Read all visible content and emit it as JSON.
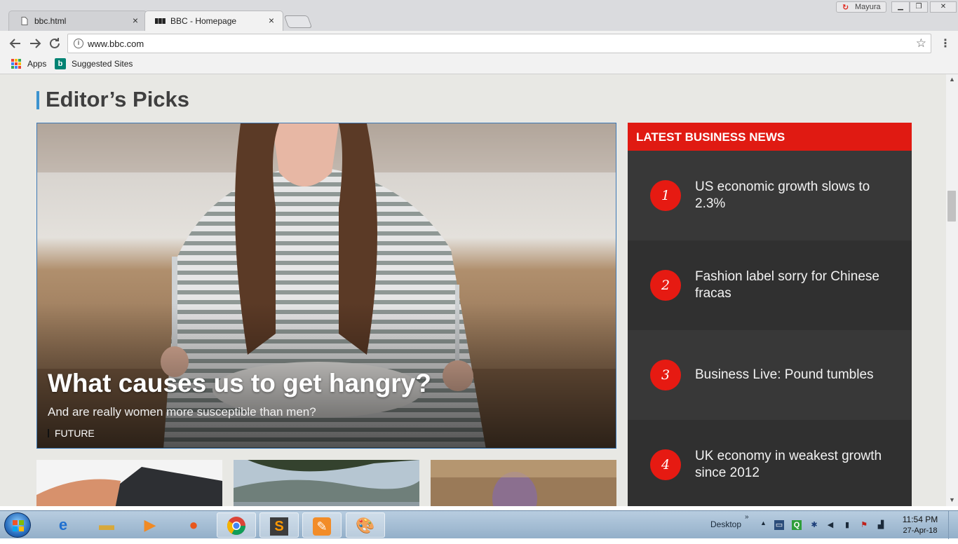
{
  "browser": {
    "tabs": [
      {
        "title": "bbc.html",
        "active": false,
        "icon": "file-icon"
      },
      {
        "title": "BBC - Homepage",
        "active": true,
        "icon": "bbc-favicon"
      }
    ],
    "close_glyph": "×",
    "profile_name": "Mayura",
    "url": "www.bbc.com",
    "bookmarks": {
      "apps": "Apps",
      "suggested": "Suggested Sites"
    }
  },
  "page": {
    "section_title": "Editor’s Picks",
    "hero": {
      "title": "What causes us to get hangry?",
      "summary": "And are really women more susceptible than men?",
      "tag": "FUTURE"
    },
    "business_news": {
      "header": "LATEST BUSINESS NEWS",
      "items": [
        {
          "rank": "1",
          "headline": "US economic growth slows to 2.3%"
        },
        {
          "rank": "2",
          "headline": "Fashion label sorry for Chinese fracas"
        },
        {
          "rank": "3",
          "headline": "Business Live: Pound tumbles"
        },
        {
          "rank": "4",
          "headline": "UK economy in weakest growth since 2012"
        }
      ]
    },
    "colors": {
      "accent_blue": "#3c93cf",
      "news_red": "#e01a12",
      "news_dark": "#333333"
    }
  },
  "taskbar": {
    "desktop_label": "Desktop",
    "time": "11:54 PM",
    "date": "27-Apr-18",
    "pinned": [
      "internet-explorer-icon",
      "file-explorer-icon",
      "media-player-icon",
      "firefox-icon",
      "chrome-icon",
      "sublime-text-icon",
      "notes-app-icon",
      "paint-icon"
    ]
  }
}
